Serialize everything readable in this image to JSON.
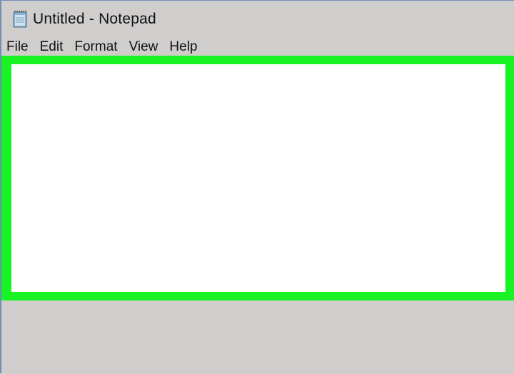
{
  "window": {
    "title": "Untitled - Notepad",
    "icon": "notepad-icon"
  },
  "menubar": {
    "items": [
      {
        "label": "File"
      },
      {
        "label": "Edit"
      },
      {
        "label": "Format"
      },
      {
        "label": "View"
      },
      {
        "label": "Help"
      }
    ]
  },
  "editor": {
    "text": "",
    "highlight_color": "#19f324"
  }
}
